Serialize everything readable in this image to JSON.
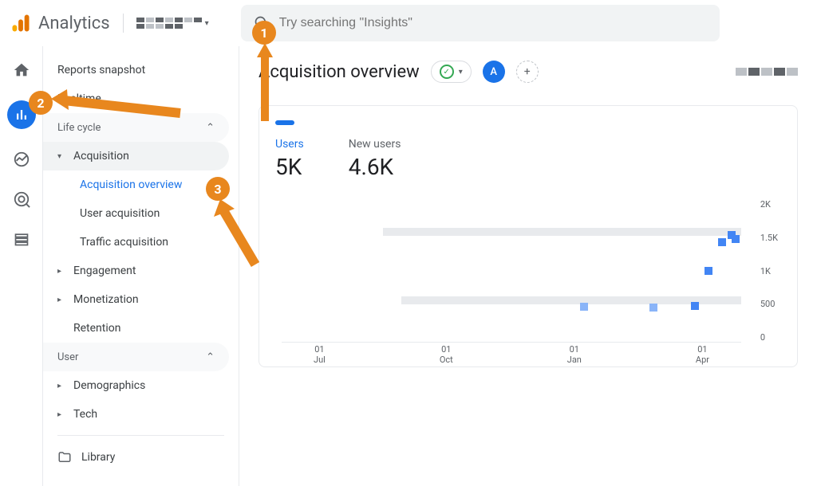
{
  "header": {
    "product": "Analytics",
    "search_placeholder": "Try searching \"Insights\""
  },
  "sidebar": {
    "reports_snapshot": "Reports snapshot",
    "realtime": "Realtime",
    "life_cycle": "Life cycle",
    "acquisition": "Acquisition",
    "acquisition_overview": "Acquisition overview",
    "user_acquisition": "User acquisition",
    "traffic_acquisition": "Traffic acquisition",
    "engagement": "Engagement",
    "monetization": "Monetization",
    "retention": "Retention",
    "user": "User",
    "demographics": "Demographics",
    "tech": "Tech",
    "library": "Library"
  },
  "page": {
    "title": "Acquisition overview",
    "avatar_letter": "A",
    "add_symbol": "+"
  },
  "metrics": {
    "users_label": "Users",
    "users_value": "5K",
    "new_users_label": "New users",
    "new_users_value": "4.6K"
  },
  "annotations": {
    "one": "1",
    "two": "2",
    "three": "3"
  },
  "chart_data": {
    "type": "bar",
    "title": "",
    "xlabel": "",
    "ylabel": "",
    "ylim": [
      0,
      2000
    ],
    "y_ticks": [
      "2K",
      "1.5K",
      "1K",
      "500",
      "0"
    ],
    "categories": [
      "01\nJul",
      "01\nOct",
      "01\nJan",
      "01\nApr"
    ],
    "series": [
      {
        "name": "Users",
        "color": "#4285f4"
      },
      {
        "name": "New users",
        "color": "#8ab4f8"
      }
    ],
    "points": [
      {
        "x_pct": 65,
        "y": 500,
        "color": "#8ab4f8"
      },
      {
        "x_pct": 80,
        "y": 490,
        "color": "#8ab4f8"
      },
      {
        "x_pct": 89,
        "y": 510,
        "color": "#4285f4"
      },
      {
        "x_pct": 92,
        "y": 1000,
        "color": "#4285f4"
      },
      {
        "x_pct": 95,
        "y": 1400,
        "color": "#4285f4"
      },
      {
        "x_pct": 97,
        "y": 1500,
        "color": "#4285f4"
      },
      {
        "x_pct": 98,
        "y": 1450,
        "color": "#4285f4"
      }
    ]
  }
}
